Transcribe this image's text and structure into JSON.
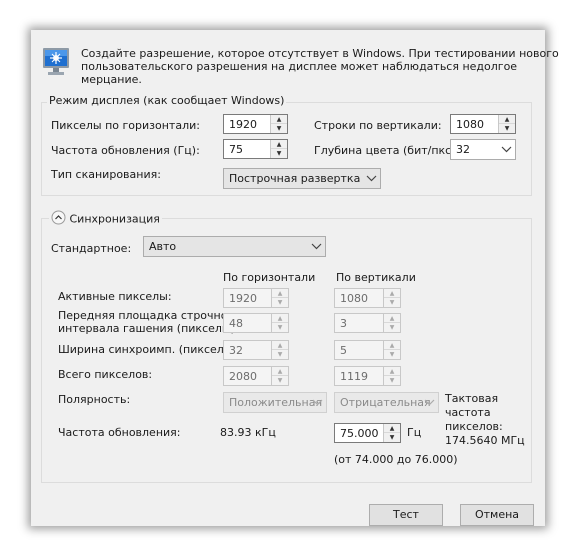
{
  "header": {
    "text_line1": "Создайте разрешение, которое отсутствует в Windows. При тестировании нового",
    "text_line2": "пользовательского разрешения на дисплее может наблюдаться недолгое",
    "text_line3": "мерцание.",
    "icon": "monitor-icon"
  },
  "display_mode": {
    "legend": "Режим дисплея (как сообщает Windows)",
    "h_pixels_label": "Пикселы по горизонтали:",
    "h_pixels_value": "1920",
    "v_lines_label": "Строки по вертикали:",
    "v_lines_value": "1080",
    "refresh_label": "Частота обновления (Гц):",
    "refresh_value": "75",
    "color_depth_label": "Глубина цвета (бит/пкс):",
    "color_depth_value": "32",
    "scan_type_label": "Тип сканирования:",
    "scan_type_value": "Построчная развертка"
  },
  "sync": {
    "legend": "Синхронизация",
    "standard_label": "Стандартное:",
    "standard_value": "Авто",
    "col_horizontal": "По горизонтали",
    "col_vertical": "По вертикали",
    "rows": [
      {
        "label": "Активные пикселы:",
        "h": "1920",
        "v": "1080"
      },
      {
        "label_line1": "Передняя площадка строчного",
        "label_line2": "интервала гашения (пикселы):",
        "h": "48",
        "v": "3"
      },
      {
        "label": "Ширина синхроимп. (пикселы):",
        "h": "32",
        "v": "5"
      },
      {
        "label": "Всего пикселов:",
        "h": "2080",
        "v": "1119"
      }
    ],
    "polarity_label": "Полярность:",
    "polarity_h": "Положительная",
    "polarity_v": "Отрицательная",
    "pixel_clock_line1": "Тактовая",
    "pixel_clock_line2": "частота",
    "pixel_clock_line3": "пикселов:",
    "pixel_clock_value": "174.5640 МГц",
    "refresh_label": "Частота обновления:",
    "h_refresh": "83.93 кГц",
    "v_refresh": "75.000",
    "v_refresh_unit": "Гц",
    "range_text": "(от 74.000 до 76.000)"
  },
  "buttons": {
    "test": "Тест",
    "cancel": "Отмена"
  },
  "colors": {
    "window_bg": "#f0f0f0",
    "monitor_blue": "#1e6fd0"
  }
}
